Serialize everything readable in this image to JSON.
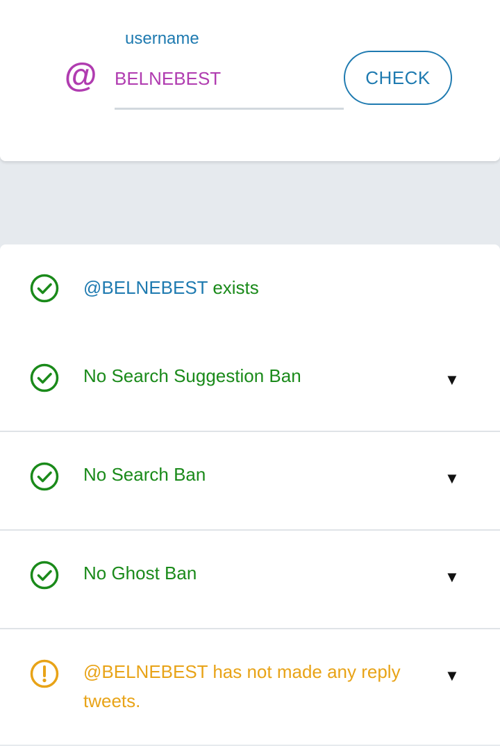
{
  "search": {
    "label": "username",
    "at_symbol": "@",
    "value": "BELNEBEST",
    "button_label": "CHECK"
  },
  "results": {
    "exists": {
      "handle": "@BELNEBEST",
      "suffix": " exists",
      "status": "ok"
    },
    "items": [
      {
        "text": "No Search Suggestion Ban",
        "status": "ok"
      },
      {
        "text": "No Search Ban",
        "status": "ok"
      },
      {
        "text": "No Ghost Ban",
        "status": "ok"
      },
      {
        "handle": "@BELNEBEST",
        "text": " has not made any reply tweets.",
        "status": "warning"
      }
    ],
    "expand_glyph": "▼"
  },
  "colors": {
    "accent": "#1e7ab0",
    "username": "#b03cb0",
    "ok": "#1a8a1a",
    "warning": "#e8a317",
    "background": "#e6eaee"
  },
  "icons": {
    "ok": "check-circle-icon",
    "warning": "exclamation-circle-icon",
    "expand": "triangle-down-icon"
  }
}
